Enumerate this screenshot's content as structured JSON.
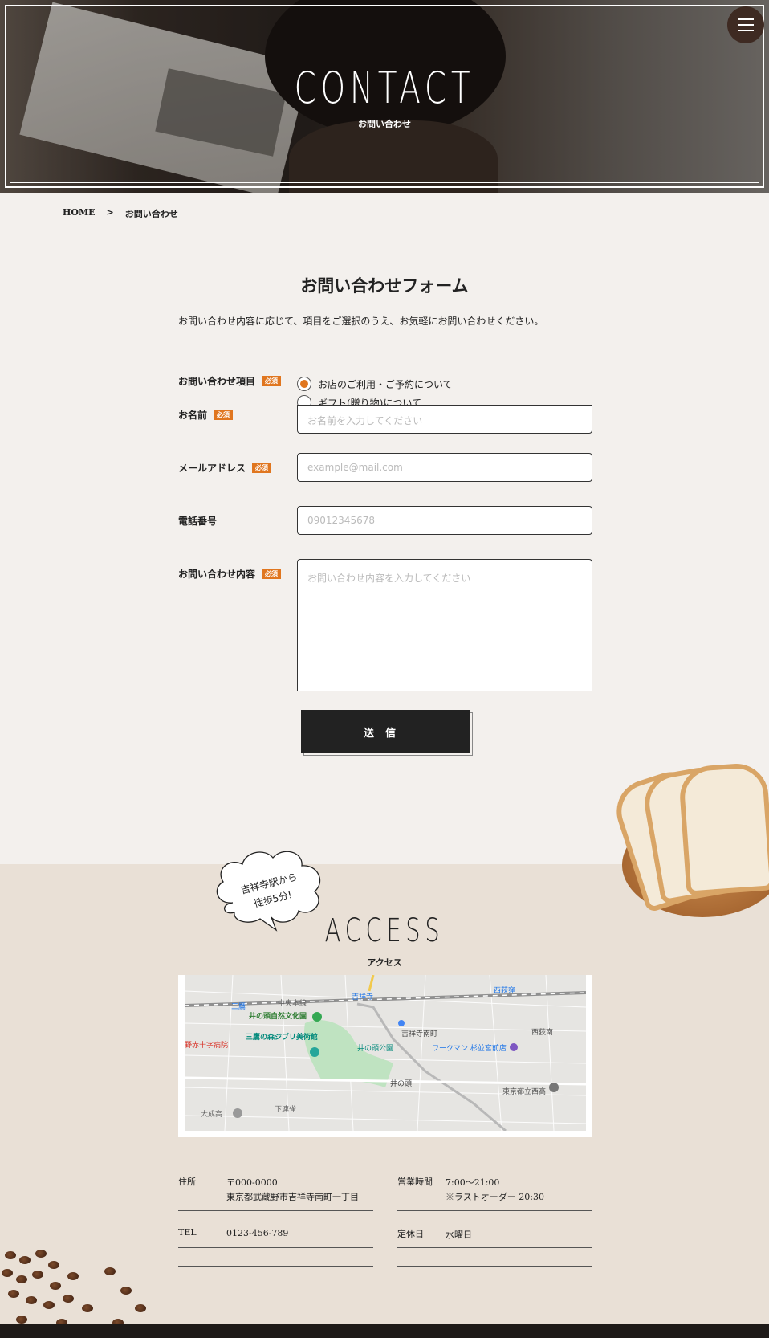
{
  "hero": {
    "title": "CONTACT",
    "subtitle": "お問い合わせ"
  },
  "breadcrumb": {
    "home": "HOME",
    "separator": ">",
    "current": "お問い合わせ"
  },
  "form": {
    "title": "お問い合わせフォーム",
    "lead": "お問い合わせ内容に応じて、項目をご選択のうえ、お気軽にお問い合わせください。",
    "required_badge": "必須",
    "inquiry_type": {
      "label": "お問い合わせ項目",
      "options": [
        "お店のご利用・ご予約について",
        "ギフト(贈り物)について"
      ],
      "selected": 0
    },
    "name": {
      "label": "お名前",
      "placeholder": "お名前を入力してください"
    },
    "email": {
      "label": "メールアドレス",
      "placeholder": "example@mail.com"
    },
    "phone": {
      "label": "電話番号",
      "placeholder": "09012345678"
    },
    "message": {
      "label": "お問い合わせ内容",
      "placeholder": "お問い合わせ内容を入力してください"
    },
    "submit_label": "送信"
  },
  "access": {
    "bubble_line1": "吉祥寺駅から",
    "bubble_line2": "徒歩5分!",
    "title": "ACCESS",
    "subtitle": "アクセス",
    "map_labels": {
      "l1": "井の頭自然文化園",
      "l2": "三鷹の森ジブリ美術館",
      "l3": "野赤十字病院",
      "l4": "井の頭公園",
      "l5": "吉祥寺南町",
      "l6": "ワークマン 杉並宮前店",
      "l7": "西荻南",
      "l8": "東京都立西高",
      "l9": "井の頭",
      "l10": "大成高",
      "l11": "下連雀",
      "l12": "西荻窪",
      "l13": "中央本線",
      "l14": "吉祥寺",
      "l15": "三鷹"
    },
    "address_label": "住所",
    "address_zip": "〒000-0000",
    "address_line": "東京都武蔵野市吉祥寺南町一丁目",
    "tel_label": "TEL",
    "tel_value": "0123-456-789",
    "hours_label": "営業時間",
    "hours_value": "7:00〜21:00",
    "hours_note": "※ラストオーダー 20:30",
    "closed_label": "定休日",
    "closed_value": "水曜日"
  },
  "colors": {
    "accent": "#e0761f",
    "dark": "#222222",
    "bg": "#f3f0ed",
    "access_bg": "#e9e0d6",
    "menu": "#3e2a22"
  }
}
